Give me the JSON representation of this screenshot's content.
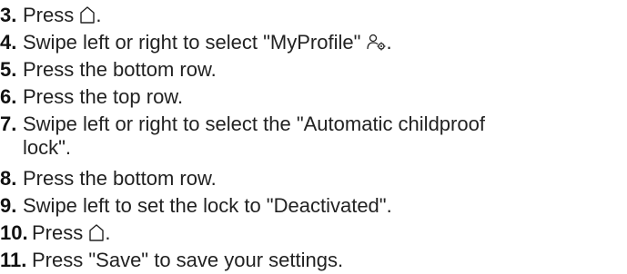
{
  "steps": [
    {
      "number": "3.",
      "text": "Press",
      "after": ".",
      "icon": "home-icon"
    },
    {
      "number": "4.",
      "text": "Swipe left or right to select \"MyProfile\"",
      "after": ".",
      "icon": "profile-settings-icon"
    },
    {
      "number": "5.",
      "text": "Press the bottom row."
    },
    {
      "number": "6.",
      "text": "Press the top row."
    },
    {
      "number": "7.",
      "text": "Swipe left or right to select the \"Automatic childproof",
      "text2": "lock\"."
    },
    {
      "number": "8.",
      "text": "Press the bottom row."
    },
    {
      "number": "9.",
      "text": "Swipe left to set the lock to \"Deactivated\"."
    },
    {
      "number": "10.",
      "text": "Press",
      "after": ".",
      "icon": "home-icon"
    },
    {
      "number": "11.",
      "text": "Press \"Save\" to save your settings."
    }
  ]
}
